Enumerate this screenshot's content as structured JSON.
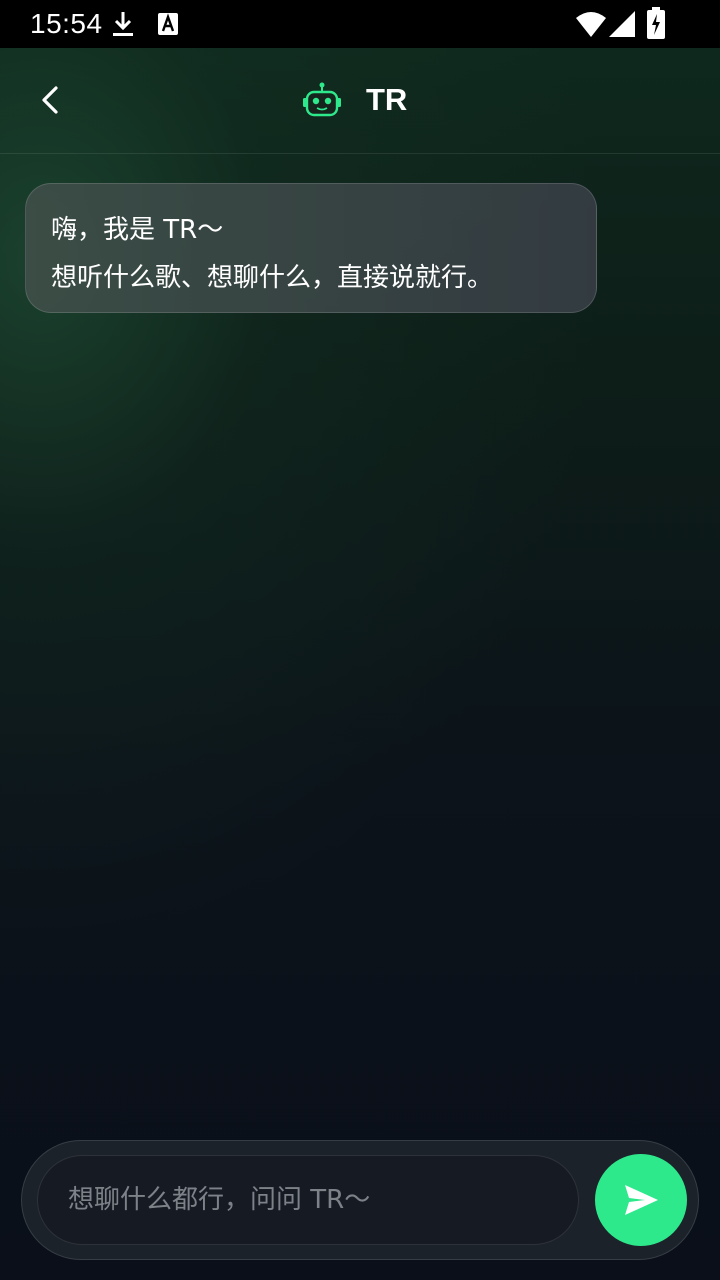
{
  "status_bar": {
    "time": "15:54",
    "icons": [
      "download-icon",
      "a-notification-icon",
      "wifi-icon",
      "signal-icon",
      "battery-charging-icon"
    ]
  },
  "header": {
    "title": "TR",
    "back_icon": "chevron-left-icon",
    "avatar_icon": "robot-icon"
  },
  "messages": [
    {
      "sender": "bot",
      "lines": [
        "嗨，我是 TR～",
        "想听什么歌、想聊什么，直接说就行。"
      ]
    }
  ],
  "composer": {
    "placeholder": "想聊什么都行，问问 TR～",
    "value": "",
    "send_icon": "send-icon"
  },
  "colors": {
    "accent": "#2ee88c",
    "background": "#0b0f17",
    "bubble": "#3a4644"
  }
}
